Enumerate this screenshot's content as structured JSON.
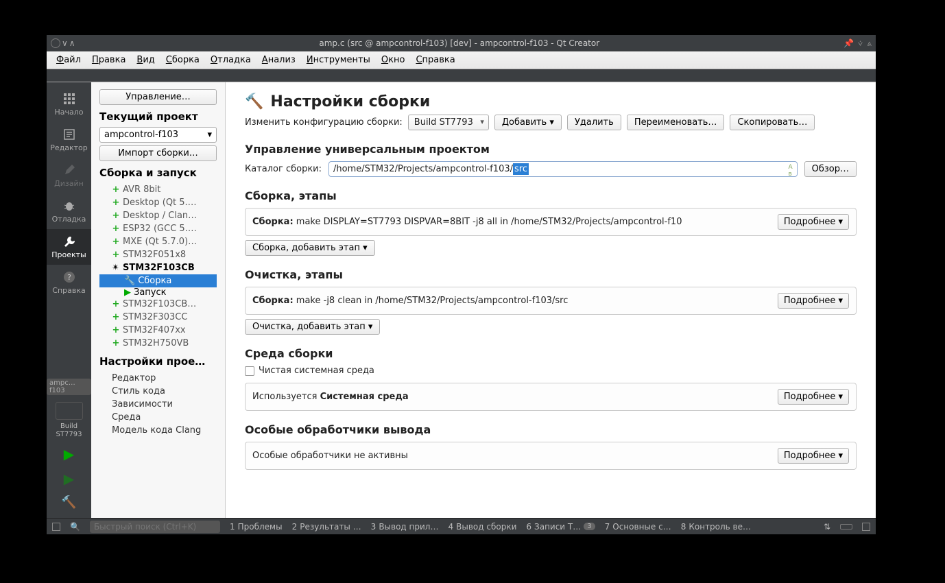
{
  "window": {
    "title": "amp.c (src @ ampcontrol-f103) [dev] - ampcontrol-f103 - Qt Creator"
  },
  "menubar": {
    "items": [
      {
        "u": "Ф",
        "rest": "айл"
      },
      {
        "u": "П",
        "rest": "равка"
      },
      {
        "u": "В",
        "rest": "ид"
      },
      {
        "u": "С",
        "rest": "борка"
      },
      {
        "u": "О",
        "rest": "тладка"
      },
      {
        "u": "А",
        "rest": "нализ"
      },
      {
        "u": "И",
        "rest": "нструменты"
      },
      {
        "u": "О",
        "rest": "кно"
      },
      {
        "u": "С",
        "rest": "правка"
      }
    ]
  },
  "rail": {
    "items": [
      {
        "label": "Начало",
        "icon": "grid"
      },
      {
        "label": "Редактор",
        "icon": "edit"
      },
      {
        "label": "Дизайн",
        "icon": "pencil",
        "dim": true
      },
      {
        "label": "Отладка",
        "icon": "bug"
      },
      {
        "label": "Проекты",
        "icon": "wrench",
        "sel": true
      },
      {
        "label": "Справка",
        "icon": "help"
      }
    ],
    "project_short": "ampc…f103",
    "build_label": "Build\nST7793"
  },
  "sidebar": {
    "manage_btn": "Управление…",
    "current_project_title": "Текущий проект",
    "project_name": "ampcontrol-f103",
    "import_btn": "Импорт сборки…",
    "build_run_title": "Сборка и запуск",
    "kits": [
      "AVR 8bit",
      "Desktop (Qt 5.…",
      "Desktop / Clan…",
      "ESP32 (GCC 5.…",
      "MXE (Qt 5.7.0)…",
      "STM32F051x8"
    ],
    "active_kit": "STM32F103CB",
    "sub_build": "Сборка",
    "sub_run": "Запуск",
    "kits_after": [
      "STM32F103CB…",
      "STM32F303CC",
      "STM32F407xx",
      "STM32H750VB"
    ],
    "proj_settings_title": "Настройки прое…",
    "proj_settings": [
      "Редактор",
      "Стиль кода",
      "Зависимости",
      "Среда",
      "Модель кода Clang"
    ]
  },
  "content": {
    "title": "Настройки сборки",
    "cfg_label": "Изменить конфигурацию сборки:",
    "cfg_value": "Build ST7793",
    "add_btn": "Добавить",
    "delete_btn": "Удалить",
    "rename_btn": "Переименовать…",
    "copy_btn": "Скопировать…",
    "generic_title": "Управление универсальным проектом",
    "build_dir_label": "Каталог сборки:",
    "build_dir_value_prefix": "/home/STM32/Projects/ampcontrol-f103/",
    "build_dir_value_sel": "src",
    "browse_btn": "Обзор…",
    "build_steps_title": "Сборка, этапы",
    "build_step_label": "Сборка:",
    "build_step_cmd": "make DISPLAY=ST7793 DISPVAR=8BIT -j8 all in /home/STM32/Projects/ampcontrol-f10",
    "details_btn": "Подробнее",
    "build_add_step_btn": "Сборка, добавить этап",
    "clean_steps_title": "Очистка, этапы",
    "clean_step_label": "Сборка:",
    "clean_step_cmd": "make -j8 clean in /home/STM32/Projects/ampcontrol-f103/src",
    "clean_add_step_btn": "Очистка, добавить этап",
    "env_title": "Среда сборки",
    "clean_env_chk": "Чистая системная среда",
    "env_uses_prefix": "Используется ",
    "env_uses_bold": "Системная среда",
    "parsers_title": "Особые обработчики вывода",
    "parsers_text": "Особые обработчики не активны"
  },
  "bottom": {
    "search_placeholder": "Быстрый поиск (Ctrl+K)",
    "tabs": [
      {
        "n": "1",
        "t": "Проблемы"
      },
      {
        "n": "2",
        "t": "Результаты …"
      },
      {
        "n": "3",
        "t": "Вывод прил…"
      },
      {
        "n": "4",
        "t": "Вывод сборки"
      },
      {
        "n": "6",
        "t": "Записи Т…",
        "badge": "3"
      },
      {
        "n": "7",
        "t": "Основные с…"
      },
      {
        "n": "8",
        "t": "Контроль ве…"
      }
    ]
  }
}
